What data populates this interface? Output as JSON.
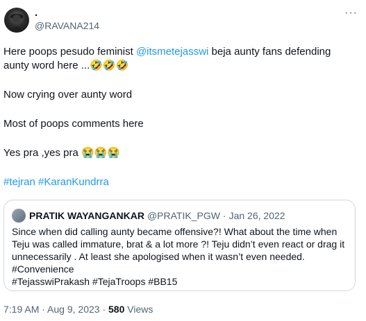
{
  "author": {
    "display_name": ".",
    "handle": "@RAVANA214"
  },
  "more_icon": "more-horizontal-icon",
  "tweet": {
    "line1_prefix": "Here poops pesudo feminist ",
    "line1_mention": "@itsmetejasswi",
    "line1_suffix": "  beja aunty fans defending",
    "line2": "aunty word here  ...",
    "line2_emoji": "🤣🤣🤣",
    "line3": "Now crying over  aunty word",
    "line4": "Most of poops comments here",
    "line5": "Yes pra ,yes pra ",
    "line5_emoji": "😭😭😭",
    "hashtag1": "#tejran",
    "hashtag2": "#KaranKundrra"
  },
  "quote": {
    "name": "PRATIK WAYANGANKAR",
    "handle": "@PRATIK_PGW",
    "dot": "·",
    "date": "Jan 26, 2022",
    "lines": [
      "Since when did calling aunty became offensive?! What about the time when",
      "Teju was called immature, brat & a lot more ?! Teju didn’t even react or drag it",
      "unnecessarily . At least she apologised when it wasn’t even needed.",
      "#Convenience",
      "#TejasswiPrakash #TejaTroops #BB15"
    ]
  },
  "meta": {
    "time": "7:19 AM",
    "dot1": " · ",
    "date": "Aug 9, 2023",
    "dot2": " · ",
    "views_count": "580",
    "views_label": " Views"
  },
  "colors": {
    "link": "#1d9bf0",
    "text": "#0f1419",
    "secondary": "#536471",
    "border": "#cfd9de"
  }
}
